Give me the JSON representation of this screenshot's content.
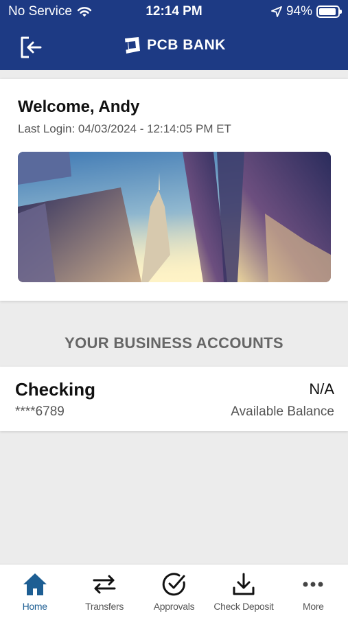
{
  "status_bar": {
    "carrier": "No Service",
    "time": "12:14 PM",
    "battery_percent": "94%",
    "battery_level": 0.94
  },
  "header": {
    "brand_name": "PCB BANK",
    "logout_icon": "logout-icon"
  },
  "welcome": {
    "title": "Welcome, Andy",
    "last_login": "Last Login: 04/03/2024 - 12:14:05 PM ET"
  },
  "accounts": {
    "heading": "YOUR BUSINESS ACCOUNTS",
    "items": [
      {
        "name": "Checking",
        "number": "****6789",
        "balance": "N/A",
        "balance_label": "Available Balance"
      }
    ]
  },
  "tabs": [
    {
      "label": "Home",
      "icon": "home-icon",
      "active": true
    },
    {
      "label": "Transfers",
      "icon": "transfer-arrows-icon",
      "active": false
    },
    {
      "label": "Approvals",
      "icon": "check-circle-icon",
      "active": false
    },
    {
      "label": "Check Deposit",
      "icon": "download-tray-icon",
      "active": false
    },
    {
      "label": "More",
      "icon": "more-dots-icon",
      "active": false
    }
  ],
  "colors": {
    "header_bg": "#1d3a84",
    "active_tab": "#1d5e93",
    "background": "#ececec"
  }
}
